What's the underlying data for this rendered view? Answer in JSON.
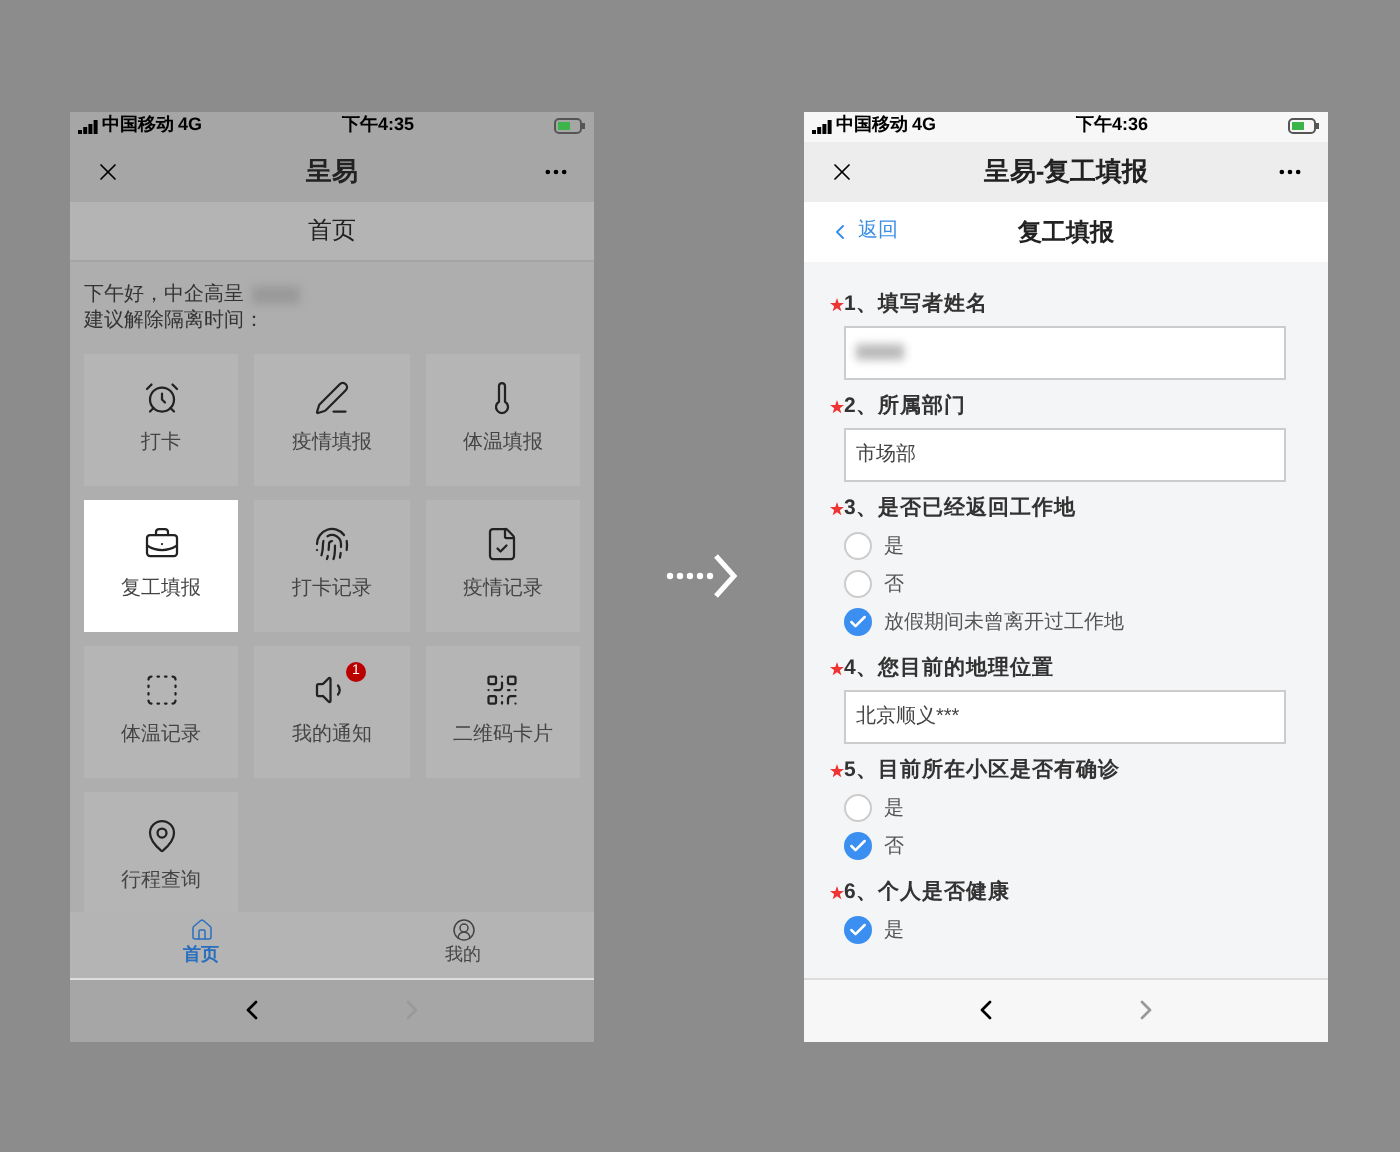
{
  "left_phone": {
    "status_bar": {
      "carrier": "中国移动",
      "network": "4G",
      "time": "下午4:35"
    },
    "title": "呈易",
    "page_title": "首页",
    "greeting": "下午好，中企高呈",
    "advice": "建议解除隔离时间：",
    "tiles": [
      {
        "label": "打卡",
        "highlighted": false
      },
      {
        "label": "疫情填报",
        "highlighted": false
      },
      {
        "label": "体温填报",
        "highlighted": false
      },
      {
        "label": "复工填报",
        "highlighted": true
      },
      {
        "label": "打卡记录",
        "highlighted": false
      },
      {
        "label": "疫情记录",
        "highlighted": false
      },
      {
        "label": "体温记录",
        "highlighted": false
      },
      {
        "label": "我的通知",
        "highlighted": false,
        "badge": "1"
      },
      {
        "label": "二维码卡片",
        "highlighted": false
      },
      {
        "label": "行程查询",
        "highlighted": false
      }
    ],
    "tabbar": [
      {
        "label": "首页",
        "selected": true
      },
      {
        "label": "我的",
        "selected": false
      }
    ]
  },
  "right_phone": {
    "status_bar": {
      "carrier": "中国移动",
      "network": "4G",
      "time": "下午4:36"
    },
    "title": "呈易-复工填报",
    "back": "返回",
    "page_title": "复工填报",
    "questions": [
      {
        "label": "1、填写者姓名",
        "required": true,
        "kind": "text"
      },
      {
        "label": "2、所属部门",
        "required": true,
        "kind": "text",
        "value": "市场部"
      },
      {
        "label": "3、是否已经返回工作地",
        "required": true,
        "kind": "radio",
        "options": [
          {
            "label": "是",
            "selected": false
          },
          {
            "label": "否",
            "selected": false
          },
          {
            "label": "放假期间未曾离开过工作地",
            "selected": true
          }
        ]
      },
      {
        "label": "4、您目前的地理位置",
        "required": true,
        "kind": "text",
        "value": "北京顺义***"
      },
      {
        "label": "5、目前所在小区是否有确诊",
        "required": true,
        "kind": "radio",
        "options": [
          {
            "label": "是",
            "selected": false
          },
          {
            "label": "否",
            "selected": true
          }
        ]
      },
      {
        "label": "6、个人是否健康",
        "required": true,
        "kind": "radio",
        "options": [
          {
            "label": "是",
            "selected": true
          }
        ]
      }
    ]
  }
}
